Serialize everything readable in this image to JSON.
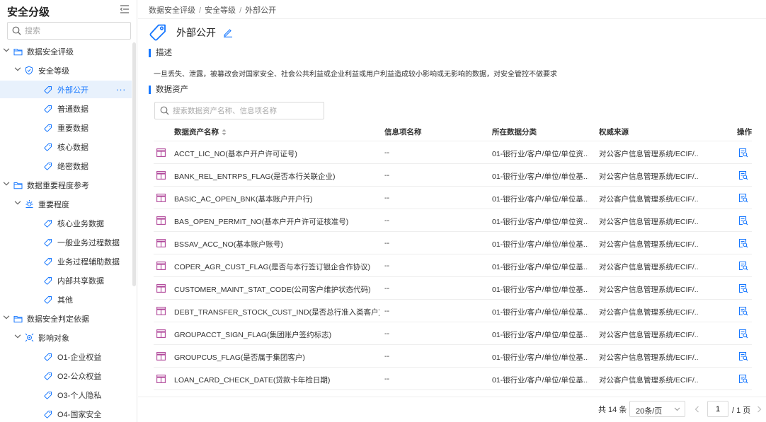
{
  "sidebar": {
    "title": "安全分级",
    "search_placeholder": "搜索",
    "tree": [
      {
        "label": "数据安全评级",
        "level": 1,
        "type": "folder",
        "expanded": true
      },
      {
        "label": "安全等级",
        "level": 2,
        "type": "shield",
        "expanded": true
      },
      {
        "label": "外部公开",
        "level": 3,
        "type": "tag",
        "active": true,
        "more": "···"
      },
      {
        "label": "普通数据",
        "level": 3,
        "type": "tag"
      },
      {
        "label": "重要数据",
        "level": 3,
        "type": "tag"
      },
      {
        "label": "核心数据",
        "level": 3,
        "type": "tag"
      },
      {
        "label": "绝密数据",
        "level": 3,
        "type": "tag"
      },
      {
        "label": "数据重要程度参考",
        "level": 1,
        "type": "folder",
        "expanded": true
      },
      {
        "label": "重要程度",
        "level": 2,
        "type": "sun",
        "expanded": true
      },
      {
        "label": "核心业务数据",
        "level": 3,
        "type": "tag"
      },
      {
        "label": "一般业务过程数据",
        "level": 3,
        "type": "tag"
      },
      {
        "label": "业务过程辅助数据",
        "level": 3,
        "type": "tag"
      },
      {
        "label": "内部共享数据",
        "level": 3,
        "type": "tag"
      },
      {
        "label": "其他",
        "level": 3,
        "type": "tag"
      },
      {
        "label": "数据安全判定依据",
        "level": 1,
        "type": "folder",
        "expanded": true
      },
      {
        "label": "影响对象",
        "level": 2,
        "type": "target",
        "expanded": true
      },
      {
        "label": "O1-企业权益",
        "level": 3,
        "type": "tag"
      },
      {
        "label": "O2-公众权益",
        "level": 3,
        "type": "tag"
      },
      {
        "label": "O3-个人隐私",
        "level": 3,
        "type": "tag"
      },
      {
        "label": "O4-国家安全",
        "level": 3,
        "type": "tag"
      }
    ]
  },
  "breadcrumb": [
    "数据安全评级",
    "安全等级",
    "外部公开"
  ],
  "page_title": "外部公开",
  "section_desc": "描述",
  "description": "一旦丢失、泄露，被篡改会对国家安全、社会公共利益或企业利益或用户利益造成较小影响或无影响的数据，对安全管控不做要求",
  "section_assets": "数据资产",
  "asset_search_placeholder": "搜索数据资产名称、信息项名称",
  "table": {
    "headers": {
      "name": "数据资产名称",
      "info": "信息项名称",
      "category": "所在数据分类",
      "source": "权威来源",
      "op": "操作"
    },
    "rows": [
      {
        "name": "ACCT_LIC_NO(基本户开户许可证号)",
        "info": "--",
        "category": "01-银行业/客户/单位/单位资...",
        "source": "对公客户信息管理系统/ECIF/..."
      },
      {
        "name": "BANK_REL_ENTRPS_FLAG(是否本行关联企业)",
        "info": "--",
        "category": "01-银行业/客户/单位/单位基...",
        "source": "对公客户信息管理系统/ECIF/..."
      },
      {
        "name": "BASIC_AC_OPEN_BNK(基本账户开户行)",
        "info": "--",
        "category": "01-银行业/客户/单位/单位基...",
        "source": "对公客户信息管理系统/ECIF/..."
      },
      {
        "name": "BAS_OPEN_PERMIT_NO(基本户开户许可证核准号)",
        "info": "--",
        "category": "01-银行业/客户/单位/单位资...",
        "source": "对公客户信息管理系统/ECIF/..."
      },
      {
        "name": "BSSAV_ACC_NO(基本账户账号)",
        "info": "--",
        "category": "01-银行业/客户/单位/单位基...",
        "source": "对公客户信息管理系统/ECIF/..."
      },
      {
        "name": "COPER_AGR_CUST_FLAG(是否与本行签订银企合作协议)",
        "info": "--",
        "category": "01-银行业/客户/单位/单位基...",
        "source": "对公客户信息管理系统/ECIF/..."
      },
      {
        "name": "CUSTOMER_MAINT_STAT_CODE(公司客户维护状态代码)",
        "info": "--",
        "category": "01-银行业/客户/单位/单位基...",
        "source": "对公客户信息管理系统/ECIF/..."
      },
      {
        "name": "DEBT_TRANSFER_STOCK_CUST_IND(是否总行准入类客户)",
        "info": "--",
        "category": "01-银行业/客户/单位/单位基...",
        "source": "对公客户信息管理系统/ECIF/..."
      },
      {
        "name": "GROUPACCT_SIGN_FLAG(集团账户签约标志)",
        "info": "--",
        "category": "01-银行业/客户/单位/单位基...",
        "source": "对公客户信息管理系统/ECIF/..."
      },
      {
        "name": "GROUPCUS_FLAG(是否属于集团客户)",
        "info": "--",
        "category": "01-银行业/客户/单位/单位基...",
        "source": "对公客户信息管理系统/ECIF/..."
      },
      {
        "name": "LOAN_CARD_CHECK_DATE(贷款卡年检日期)",
        "info": "--",
        "category": "01-银行业/客户/单位/单位基...",
        "source": "对公客户信息管理系统/ECIF/..."
      }
    ]
  },
  "pagination": {
    "total": "共 14 条",
    "page_size": "20条/页",
    "current": "1",
    "total_pages": "/ 1 页"
  },
  "colors": {
    "accent": "#1677ff",
    "table_icon": "#b0469a",
    "active_bg": "#e8f1fc"
  }
}
